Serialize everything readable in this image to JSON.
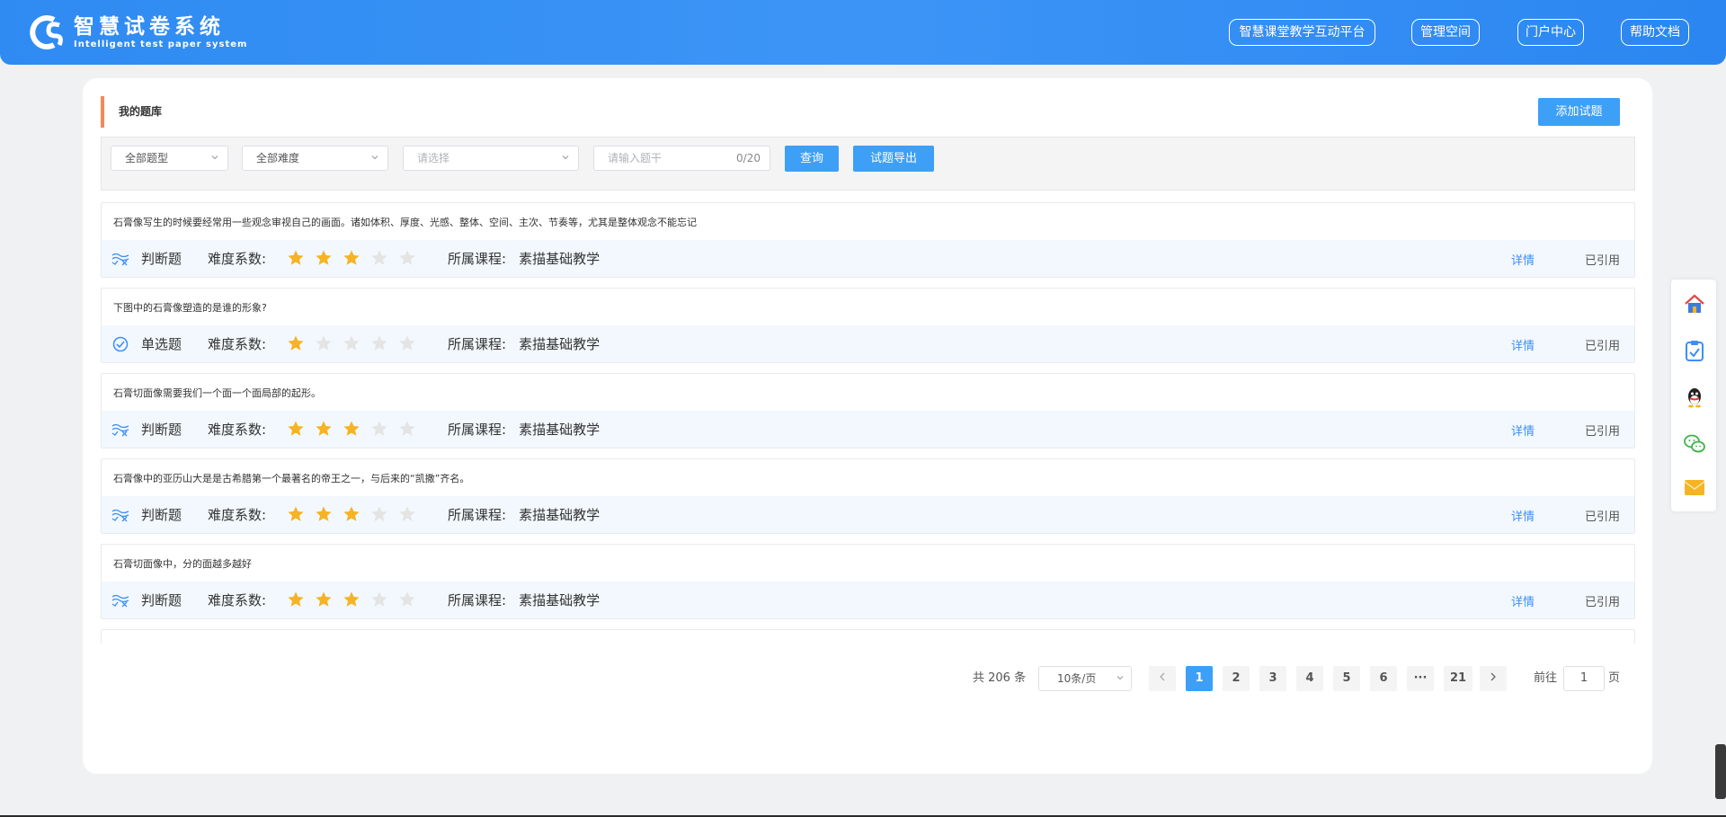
{
  "header": {
    "logo_cn": "智慧试卷系统",
    "logo_en": "Intelligent test paper system",
    "nav": [
      "智慧课堂教学互动平台",
      "管理空间",
      "门户中心",
      "帮助文档"
    ]
  },
  "main": {
    "section_title": "我的题库",
    "add_button": "添加试题",
    "filters": {
      "type": "全部题型",
      "difficulty": "全部难度",
      "select_placeholder": "请选择",
      "keyword_placeholder": "请输入题干",
      "keyword_counter": "0/20",
      "query_button": "查询",
      "export_button": "试题导出"
    },
    "labels": {
      "difficulty": "难度系数:",
      "course": "所属课程:",
      "detail": "详情",
      "cited": "已引用"
    },
    "questions": [
      {
        "text": "石膏像写生的时候要经常用一些观念审视自己的画面。诸如体积、厚度、光感、整体、空间、主次、节奏等，尤其是整体观念不能忘记",
        "type": "判断题",
        "type_icon": "true-false-icon",
        "difficulty": 3,
        "course": "素描基础教学"
      },
      {
        "text": "下图中的石膏像塑造的是谁的形象?",
        "type": "单选题",
        "type_icon": "check-circle-icon",
        "difficulty": 1,
        "course": "素描基础教学"
      },
      {
        "text": "石膏切面像需要我们一个面一个面局部的起形。",
        "type": "判断题",
        "type_icon": "true-false-icon",
        "difficulty": 3,
        "course": "素描基础教学"
      },
      {
        "text": "石膏像中的亚历山大是是古希腊第一个最著名的帝王之一，与后来的“凯撒”齐名。",
        "type": "判断题",
        "type_icon": "true-false-icon",
        "difficulty": 3,
        "course": "素描基础教学"
      },
      {
        "text": "石膏切面像中，分的面越多越好",
        "type": "判断题",
        "type_icon": "true-false-icon",
        "difficulty": 3,
        "course": "素描基础教学"
      }
    ]
  },
  "pagination": {
    "total_text": "共 206 条",
    "page_size": "10条/页",
    "pages": [
      "1",
      "2",
      "3",
      "4",
      "5",
      "6",
      "···",
      "21"
    ],
    "current_page": "1",
    "goto_prefix": "前往",
    "goto_value": "1",
    "goto_suffix": "页"
  },
  "side_toolbar": [
    "home-icon",
    "clipboard-icon",
    "qq-icon",
    "wechat-icon",
    "mail-icon"
  ],
  "colors": {
    "header_blue": "#2f8bf2",
    "accent_blue": "#3d9ff6",
    "star": "#f6b324",
    "title_bar": "#f28a5b"
  }
}
